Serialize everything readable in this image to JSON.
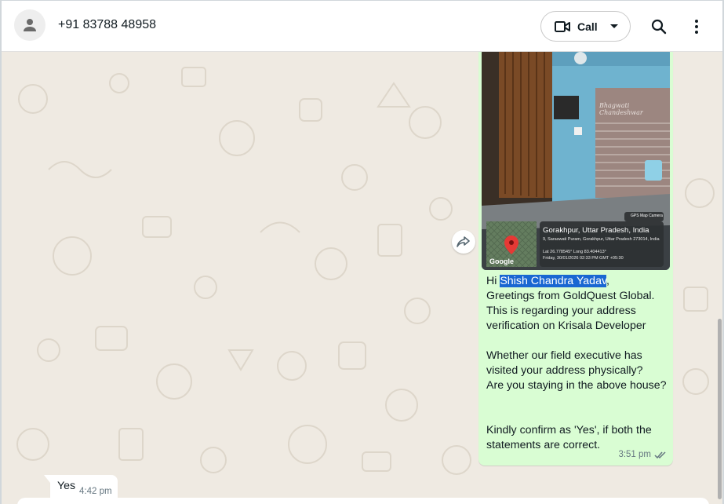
{
  "header": {
    "contact": "+91 83788 48958",
    "call_label": "Call"
  },
  "message_out": {
    "photo": {
      "location_title": "Gorakhpur, Uttar Pradesh, India",
      "address": "9, Saraswati Puram, Gorakhpur, Uttar Pradesh 273014, India",
      "coords": "Lat 26.778545° Long 83.404413°",
      "datetime": "Friday, 30/01/2026 02:33 PM GMT +05:30",
      "camera_label": "GPS Map Camera",
      "map_logo": "Google",
      "nameplate": "Bhagwati Chandeshwar"
    },
    "greeting_prefix": "Hi ",
    "highlighted_name": "Shish Chandra Yadav",
    "after_name": ",\nGreetings from GoldQuest Global.\nThis is regarding your address verification on Krisala Developer\n\nWhether our field executive has visited your address physically?\nAre you staying in the above house?\n\n\nKindly confirm as 'Yes', if both the statements are correct.",
    "time": "3:51 pm"
  },
  "message_in": {
    "text": "Yes",
    "time": "4:42 pm"
  },
  "colors": {
    "outgoing_bubble": "#d9fdd3",
    "chat_bg": "#efeae2",
    "highlight": "#1967d2"
  }
}
